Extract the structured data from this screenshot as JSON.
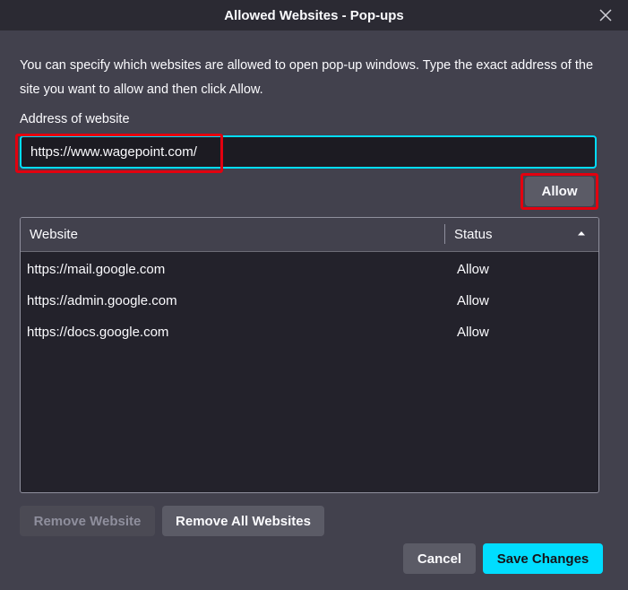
{
  "window": {
    "title": "Allowed Websites - Pop-ups"
  },
  "description": "You can specify which websites are allowed to open pop-up windows. Type the exact address of the site you want to allow and then click Allow.",
  "address": {
    "label": "Address of website",
    "value": "https://www.wagepoint.com/"
  },
  "allow_button": "Allow",
  "table": {
    "columns": [
      "Website",
      "Status"
    ],
    "sort_column": "Status",
    "rows": [
      {
        "site": "https://mail.google.com",
        "status": "Allow"
      },
      {
        "site": "https://admin.google.com",
        "status": "Allow"
      },
      {
        "site": "https://docs.google.com",
        "status": "Allow"
      }
    ]
  },
  "buttons": {
    "remove_website": "Remove Website",
    "remove_all": "Remove All Websites",
    "cancel": "Cancel",
    "save": "Save Changes"
  },
  "icons": {
    "close": "close-icon",
    "sort": "sort-ascending-icon"
  },
  "colors": {
    "accent": "#00ddff",
    "highlight": "#e3000f",
    "background": "#42414d"
  }
}
